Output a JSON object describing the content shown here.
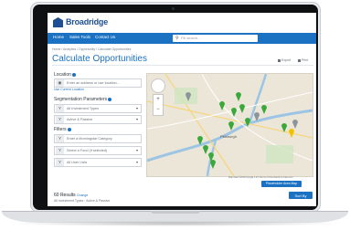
{
  "app": {
    "brand": "Broadridge",
    "nav": [
      "Home",
      "Sales Tools",
      "Contact Us"
    ],
    "search_placeholder": "Fill search...",
    "breadcrumb": "Home / Analytics / Opportunity / Calculate Opportunities",
    "title": "Calculate Opportunities",
    "top_actions": [
      "Export",
      "Print"
    ]
  },
  "location": {
    "label": "Location",
    "input_placeholder": "Enter an address or use location...",
    "link": "Use Current Location"
  },
  "segmentation": {
    "label": "Segmentation Parameters",
    "fields": [
      "All Investment Types",
      "Active & Passive"
    ]
  },
  "filters": {
    "label": "Filters",
    "fields": [
      "Enter a Morningstar Category",
      "Select a Fund (if selected)",
      "All User Lists"
    ]
  },
  "map": {
    "labels": [
      "Pittsburgh"
    ],
    "footer": "Map data ©2018 Google  1 km  Terms of Use  Report a map error",
    "button_label": "Placeholder Area Map"
  },
  "results": {
    "count": "60 Results",
    "count_link": "Change",
    "subtitle": "All Investment Types · Active & Passive",
    "sort_label": "Sort By"
  },
  "colors": {
    "brand_blue": "#1b72c2",
    "logo_blue": "#1d4f91",
    "marker_green": "#3aa83a",
    "marker_gray": "#8c949c",
    "marker_yellow": "#f2c200"
  }
}
